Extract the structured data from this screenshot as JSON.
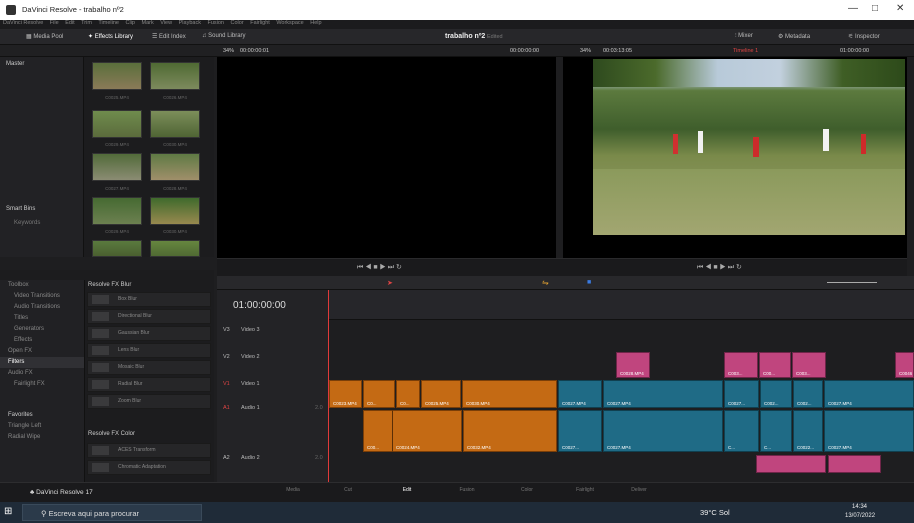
{
  "window": {
    "title": "DaVinci Resolve - trabalho nº2",
    "min": "—",
    "max": "□",
    "close": "✕"
  },
  "menu": [
    "DaVinci Resolve",
    "File",
    "Edit",
    "Trim",
    "Timeline",
    "Clip",
    "Mark",
    "View",
    "Playback",
    "Fusion",
    "Color",
    "Fairlight",
    "Workspace",
    "Help"
  ],
  "toolbar": {
    "media_pool": "Media Pool",
    "effects_library": "Effects Library",
    "edit_index": "Edit Index",
    "sound_library": "Sound Library",
    "project": "trabalho nº2",
    "edited": "Edited",
    "mixer": "Mixer",
    "metadata": "Metadata",
    "inspector": "Inspector"
  },
  "viewer_left": {
    "zoom": "34%",
    "timecode": "00:00:00:01",
    "right_tc": "00:00:00:00"
  },
  "viewer_right": {
    "zoom": "34%",
    "timecode": "00:03:13:05",
    "timeline": "Timeline 1",
    "right_tc": "01:00:00:00"
  },
  "bins": {
    "master": "Master",
    "smart_bins": "Smart Bins",
    "keywords": "Keywords"
  },
  "clips": [
    {
      "a": "C0025.MP4",
      "b": "C0026.MP4"
    },
    {
      "a": "C0029.MP4",
      "b": "C0030.MP4"
    },
    {
      "a": "C0027.MP4",
      "b": "C0028.MP4"
    },
    {
      "a": "C0029.MP4",
      "b": "C0030.MP4"
    }
  ],
  "fx_categories": [
    "Toolbox",
    "Video Transitions",
    "Audio Transitions",
    "Titles",
    "Generators",
    "Effects",
    "Open FX",
    "Filters",
    "Audio FX",
    "Fairlight FX"
  ],
  "fx_favorites": {
    "label": "Favorites",
    "items": [
      "Triangle Left",
      "Radial Wipe"
    ]
  },
  "fx_group1": "Resolve FX Blur",
  "fx_items1": [
    "Box Blur",
    "Directional Blur",
    "Gaussian Blur",
    "Lens Blur",
    "Mosaic Blur",
    "Radial Blur",
    "Zoom Blur"
  ],
  "fx_group2": "Resolve FX Color",
  "fx_items2": [
    "ACES Transform",
    "Chromatic Adaptation"
  ],
  "timeline": {
    "timecode": "01:00:00:00",
    "tracks": [
      {
        "id": "V3",
        "name": "Video 3"
      },
      {
        "id": "V2",
        "name": "Video 2"
      },
      {
        "id": "V1",
        "name": "Video 1"
      },
      {
        "id": "A1",
        "name": "Audio 1",
        "level": "2.0"
      },
      {
        "id": "A2",
        "name": "Audio 2",
        "level": "2.0"
      }
    ],
    "clips_v1": [
      "C0023.MP4",
      "C0...",
      "C0...",
      "C0025.MP4",
      "C0030.MP4",
      "C0027.MP4",
      "C0027.MP4",
      "C0027...",
      "C002...",
      "C002...",
      "C0027.MP4"
    ],
    "clips_v2": [
      "C0028.MP4",
      "C003...",
      "C00...",
      "C003...",
      "C0046"
    ],
    "clips_a1": [
      "C00...",
      "C0024.MP4",
      "C0032.MP4",
      "C0027...",
      "C0027.MP4",
      "C...",
      "C...",
      "C0022...",
      "C0027.MP4"
    ]
  },
  "pages": [
    "Media",
    "Cut",
    "Edit",
    "Fusion",
    "Color",
    "Fairlight",
    "Deliver"
  ],
  "active_page": "Edit",
  "app_footer": "DaVinci Resolve 17",
  "taskbar": {
    "search": "Escreva aqui para procurar",
    "weather": "39°C Sol",
    "time": "14:34",
    "date": "13/07/2022"
  }
}
